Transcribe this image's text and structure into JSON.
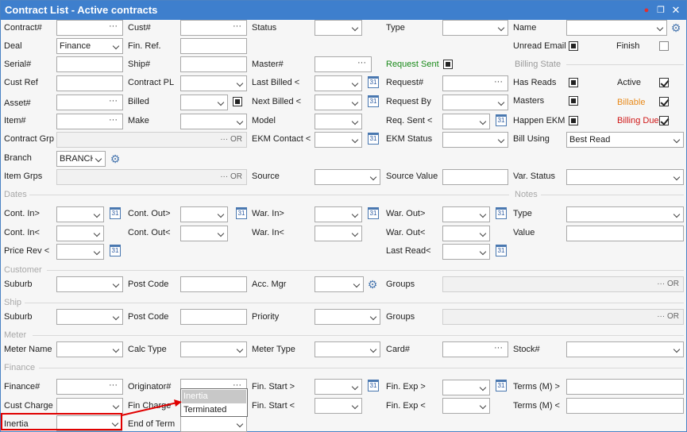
{
  "window": {
    "title": "Contract List - Active contracts",
    "pin_icon": "pin-icon",
    "restore_icon": "restore-icon",
    "close_icon": "close-icon"
  },
  "labels": {
    "contract_no": "Contract#",
    "cust_no": "Cust#",
    "status": "Status",
    "type": "Type",
    "name": "Name",
    "deal": "Deal",
    "fin_ref": "Fin. Ref.",
    "unread_email": "Unread Email",
    "finish": "Finish",
    "serial_no": "Serial#",
    "ship_no": "Ship#",
    "master_no": "Master#",
    "request_sent": "Request Sent",
    "billing_state": "Billing State",
    "cust_ref": "Cust Ref",
    "contract_pl": "Contract PL",
    "last_billed": "Last Billed <",
    "request_no": "Request#",
    "has_reads": "Has Reads",
    "active": "Active",
    "asset_no": "Asset#",
    "billed": "Billed",
    "next_billed": "Next Billed <",
    "request_by": "Request By",
    "masters": "Masters",
    "billable": "Billable",
    "item_no": "Item#",
    "make": "Make",
    "model": "Model",
    "req_sent": "Req. Sent <",
    "happen_ekm": "Happen EKM",
    "billing_due": "Billing Due",
    "contract_grp": "Contract Grp",
    "ekm_contact": "EKM Contact <",
    "ekm_status": "EKM Status",
    "bill_using": "Bill Using",
    "branch": "Branch",
    "item_grps": "Item Grps",
    "source": "Source",
    "source_value": "Source Value",
    "var_status": "Var. Status",
    "dates": "Dates",
    "notes": "Notes",
    "cont_in_gt": "Cont. In>",
    "cont_out_gt": "Cont. Out>",
    "war_in_gt": "War. In>",
    "war_out_gt": "War. Out>",
    "notes_type": "Type",
    "cont_in_lt": "Cont. In<",
    "cont_out_lt": "Cont. Out<",
    "war_in_lt": "War. In<",
    "war_out_lt": "War. Out<",
    "value": "Value",
    "price_rev": "Price Rev <",
    "last_read": "Last Read<",
    "customer": "Customer",
    "suburb": "Suburb",
    "post_code": "Post Code",
    "acc_mgr": "Acc. Mgr",
    "groups": "Groups",
    "ship": "Ship",
    "priority": "Priority",
    "meter": "Meter",
    "meter_name": "Meter Name",
    "calc_type": "Calc Type",
    "meter_type": "Meter Type",
    "card_no": "Card#",
    "stock_no": "Stock#",
    "finance": "Finance",
    "finance_no": "Finance#",
    "originator_no": "Originator#",
    "fin_start_gt": "Fin. Start >",
    "fin_exp_gt": "Fin. Exp >",
    "terms_gt": "Terms (M) >",
    "cust_charge": "Cust Charge",
    "fin_charge": "Fin Charge",
    "fin_start_lt": "Fin. Start <",
    "fin_exp_lt": "Fin. Exp <",
    "terms_lt": "Terms (M) <",
    "inertia": "Inertia",
    "end_of_term": "End of Term"
  },
  "values": {
    "deal": "Finance",
    "branch": "BRANCH1",
    "bill_using": "Best Read",
    "or": "OR",
    "dots": "···",
    "cal_day": "31"
  },
  "popup": {
    "options": [
      "Inertia",
      "Terminated"
    ],
    "selected": "Inertia"
  },
  "colors": {
    "title_bar": "#3e7fcd",
    "request_sent": "#1a8a1a",
    "billable": "#e88a1a",
    "billing_due": "#d01818",
    "highlight": "#e00000"
  }
}
